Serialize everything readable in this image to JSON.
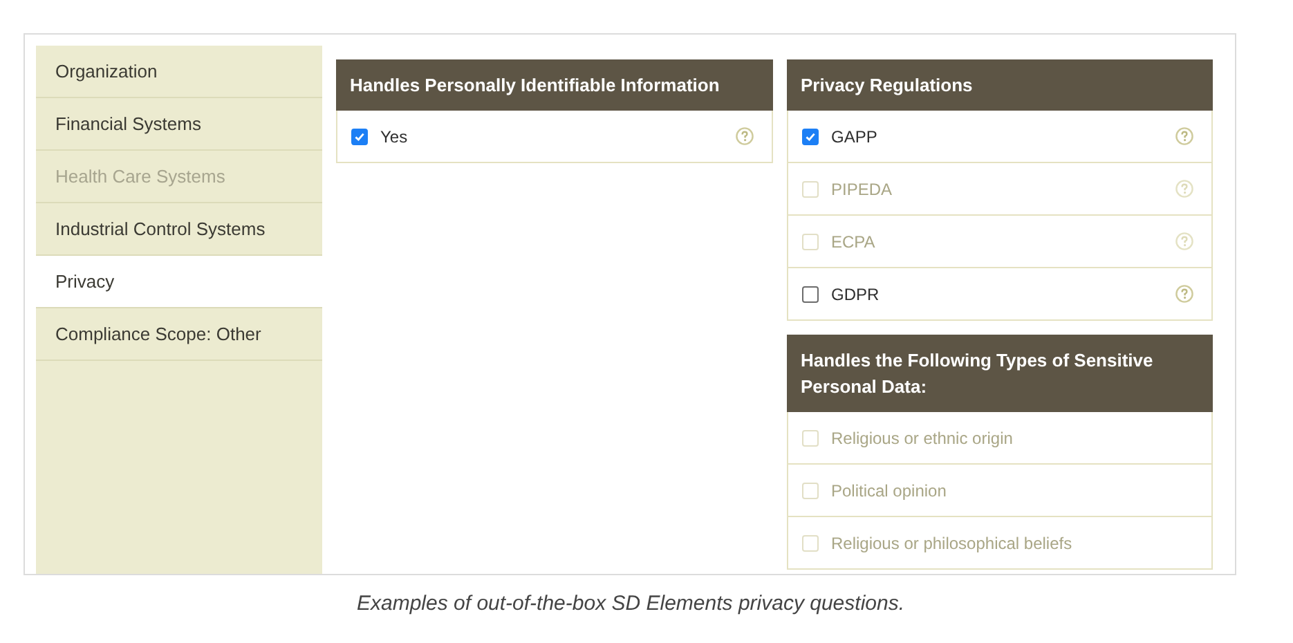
{
  "sidebar": {
    "items": [
      {
        "label": "Organization",
        "selected": false,
        "disabled": false
      },
      {
        "label": "Financial Systems",
        "selected": false,
        "disabled": false
      },
      {
        "label": "Health Care Systems",
        "selected": false,
        "disabled": true
      },
      {
        "label": "Industrial Control Systems",
        "selected": false,
        "disabled": false
      },
      {
        "label": "Privacy",
        "selected": true,
        "disabled": false
      },
      {
        "label": "Compliance Scope: Other",
        "selected": false,
        "disabled": false
      }
    ]
  },
  "columns": [
    {
      "panels": [
        {
          "title": "Handles Personally Identifiable Information",
          "options": [
            {
              "label": "Yes",
              "checked": true,
              "disabled": false,
              "help": true
            }
          ]
        }
      ]
    },
    {
      "panels": [
        {
          "title": "Privacy Regulations",
          "options": [
            {
              "label": "GAPP",
              "checked": true,
              "disabled": false,
              "help": true
            },
            {
              "label": "PIPEDA",
              "checked": false,
              "disabled": true,
              "help": true
            },
            {
              "label": "ECPA",
              "checked": false,
              "disabled": true,
              "help": true
            },
            {
              "label": "GDPR",
              "checked": false,
              "disabled": false,
              "help": true
            }
          ]
        },
        {
          "title": "Handles the Following Types of Sensitive Personal Data:",
          "options": [
            {
              "label": "Religious or ethnic origin",
              "checked": false,
              "disabled": true,
              "help": false
            },
            {
              "label": "Political opinion",
              "checked": false,
              "disabled": true,
              "help": false
            },
            {
              "label": "Religious or philosophical beliefs",
              "checked": false,
              "disabled": true,
              "help": false
            }
          ]
        }
      ]
    }
  ],
  "caption": "Examples of out-of-the-box SD Elements privacy questions."
}
